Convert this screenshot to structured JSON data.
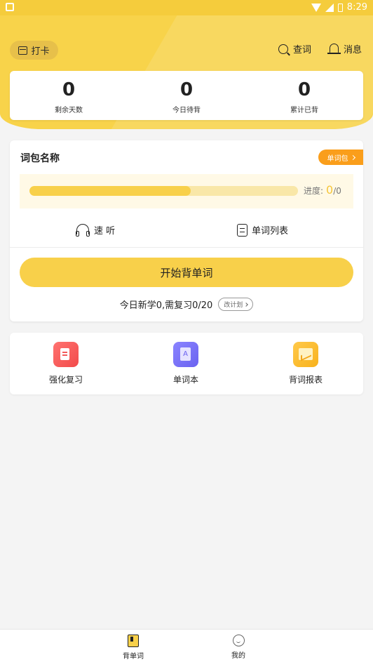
{
  "status_bar": {
    "time": "8:29"
  },
  "header": {
    "checkin_label": "打卡",
    "lookup_label": "查词",
    "messages_label": "消息"
  },
  "stats": [
    {
      "value": "0",
      "label": "剩余天数"
    },
    {
      "value": "0",
      "label": "今日待背"
    },
    {
      "value": "0",
      "label": "累计已背"
    }
  ],
  "word_package": {
    "title": "词包名称",
    "package_button": "单词包",
    "progress_label": "进度:",
    "progress_current": "0",
    "progress_total": "/0",
    "progress_fraction": 0.6,
    "quick_listen_label": "速 听",
    "word_list_label": "单词列表",
    "start_button": "开始背单词",
    "today_summary": "今日新学0,需复习0/20",
    "plan_button": "改计划"
  },
  "tools": [
    {
      "label": "强化复习",
      "icon": "review-icon"
    },
    {
      "label": "单词本",
      "icon": "wordbook-icon"
    },
    {
      "label": "背词报表",
      "icon": "report-icon"
    }
  ],
  "tabbar": [
    {
      "label": "背单词",
      "icon": "book-icon",
      "active": true
    },
    {
      "label": "我的",
      "icon": "face-icon",
      "active": false
    }
  ],
  "colors": {
    "brand_yellow": "#f8d34a",
    "accent_orange": "#fa9e1b",
    "progress_track": "#f9e7a8"
  }
}
